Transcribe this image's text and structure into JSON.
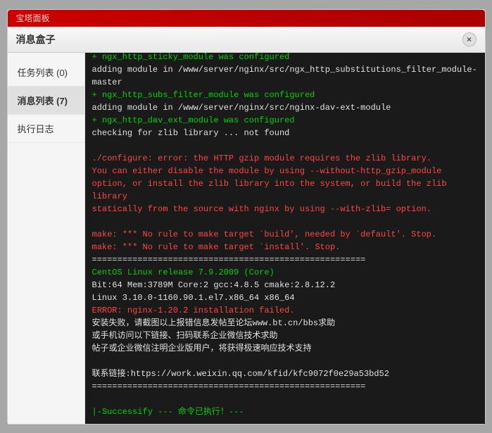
{
  "dialog": {
    "title": "消息盒子",
    "close_label": "×"
  },
  "brand": {
    "text": "宝塔面板"
  },
  "sidebar": {
    "items": [
      {
        "label": "任务列表 (0)",
        "active": false
      },
      {
        "label": "消息列表 (7)",
        "active": true
      },
      {
        "label": "执行日志",
        "active": false
      }
    ]
  },
  "terminal": {
    "lines": [
      {
        "type": "green",
        "text": "+ ngx_http_sticky_module was configured"
      },
      {
        "type": "normal",
        "text": "adding module in /www/server/nginx/src/ngx_http_substitutions_filter_module-master"
      },
      {
        "type": "green",
        "text": "+ ngx_http_subs_filter_module was configured"
      },
      {
        "type": "normal",
        "text": "adding module in /www/server/nginx/src/nginx-dav-ext-module"
      },
      {
        "type": "green",
        "text": "+ ngx_http_dav_ext_module was configured"
      },
      {
        "type": "normal",
        "text": "checking for zlib library ... not found"
      },
      {
        "type": "blank",
        "text": ""
      },
      {
        "type": "red",
        "text": "./configure: error: the HTTP gzip module requires the zlib library."
      },
      {
        "type": "red",
        "text": "You can either disable the module by using --without-http_gzip_module"
      },
      {
        "type": "red",
        "text": "option, or install the zlib library into the system, or build the zlib"
      },
      {
        "type": "red",
        "text": "library"
      },
      {
        "type": "red",
        "text": "statically from the source with nginx by using --with-zlib= option."
      },
      {
        "type": "blank",
        "text": ""
      },
      {
        "type": "red",
        "text": "make: *** No rule to make target `build', needed by `default'. Stop."
      },
      {
        "type": "red",
        "text": "make: *** No rule to make target `install'. Stop."
      },
      {
        "type": "normal",
        "text": "======================================================"
      },
      {
        "type": "green",
        "text": "CentOS Linux release 7.9.2009 (Core)"
      },
      {
        "type": "normal",
        "text": "Bit:64 Mem:3789M Core:2 gcc:4.8.5 cmake:2.8.12.2"
      },
      {
        "type": "normal",
        "text": "Linux 3.10.0-1160.90.1.el7.x86_64 x86_64"
      },
      {
        "type": "red",
        "text": "ERROR: nginx-1.20.2 installation failed."
      },
      {
        "type": "normal",
        "text": "安装失败，请截图以上报错信息发帖至论坛www.bt.cn/bbs求助"
      },
      {
        "type": "normal",
        "text": "或手机访问以下链接、扫码联系企业微信技术求助"
      },
      {
        "type": "normal",
        "text": "帖子或企业微信注明企业版用户，将获得极速响应技术支持"
      },
      {
        "type": "blank",
        "text": ""
      },
      {
        "type": "normal",
        "text": "联系链接:https://work.weixin.qq.com/kfid/kfc9072f0e29a53bd52"
      },
      {
        "type": "normal",
        "text": "======================================================"
      },
      {
        "type": "blank",
        "text": ""
      },
      {
        "type": "green",
        "text": "|-Successify --- 命令已执行！---"
      }
    ]
  }
}
